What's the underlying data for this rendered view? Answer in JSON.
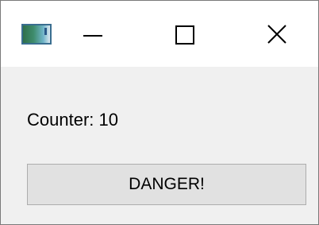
{
  "window": {
    "icon": "app-window-icon",
    "controls": {
      "minimize_icon": "minimize-icon",
      "maximize_icon": "maximize-icon",
      "close_icon": "close-icon"
    }
  },
  "content": {
    "counter_text": "Counter: 10",
    "button_label": "DANGER!"
  }
}
